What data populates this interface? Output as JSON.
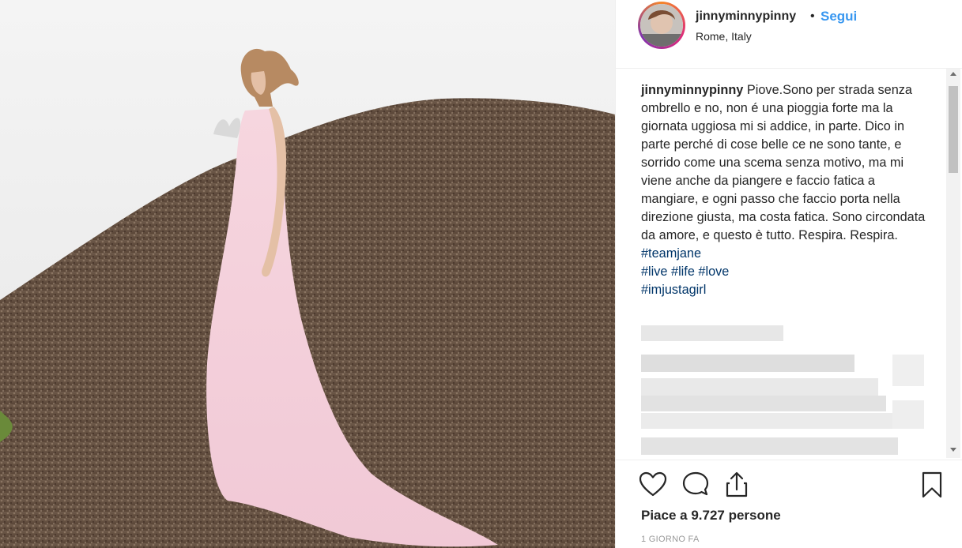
{
  "post": {
    "username": "jinnyminnypinny",
    "separator": "•",
    "follow_label": "Segui",
    "location": "Rome, Italy"
  },
  "caption": {
    "username": "jinnyminnypinny",
    "text": "Piove.Sono per strada senza ombrello e no, non é una pioggia forte ma la giornata uggiosa mi si addice, in parte. Dico in parte perché di cose belle ce ne sono tante, e sorrido come una scema senza motivo, ma mi viene anche da piangere e faccio fatica a mangiare, e ogni passo che faccio porta nella direzione giusta, ma costa fatica. Sono circondata da amore, e questo è tutto. Respira. Respira.",
    "hashtags": [
      "#teamjane",
      "#live #life #love",
      "#imjustagirl"
    ]
  },
  "likes_text": "Piace a 9.727 persone",
  "time_text": "1 GIORNO FA",
  "icons": {
    "like": "heart-icon",
    "comment": "comment-icon",
    "share": "share-icon",
    "save": "bookmark-icon"
  },
  "colors": {
    "link": "#3897f0",
    "hashtag": "#003569",
    "text": "#262626",
    "muted": "#999999"
  }
}
